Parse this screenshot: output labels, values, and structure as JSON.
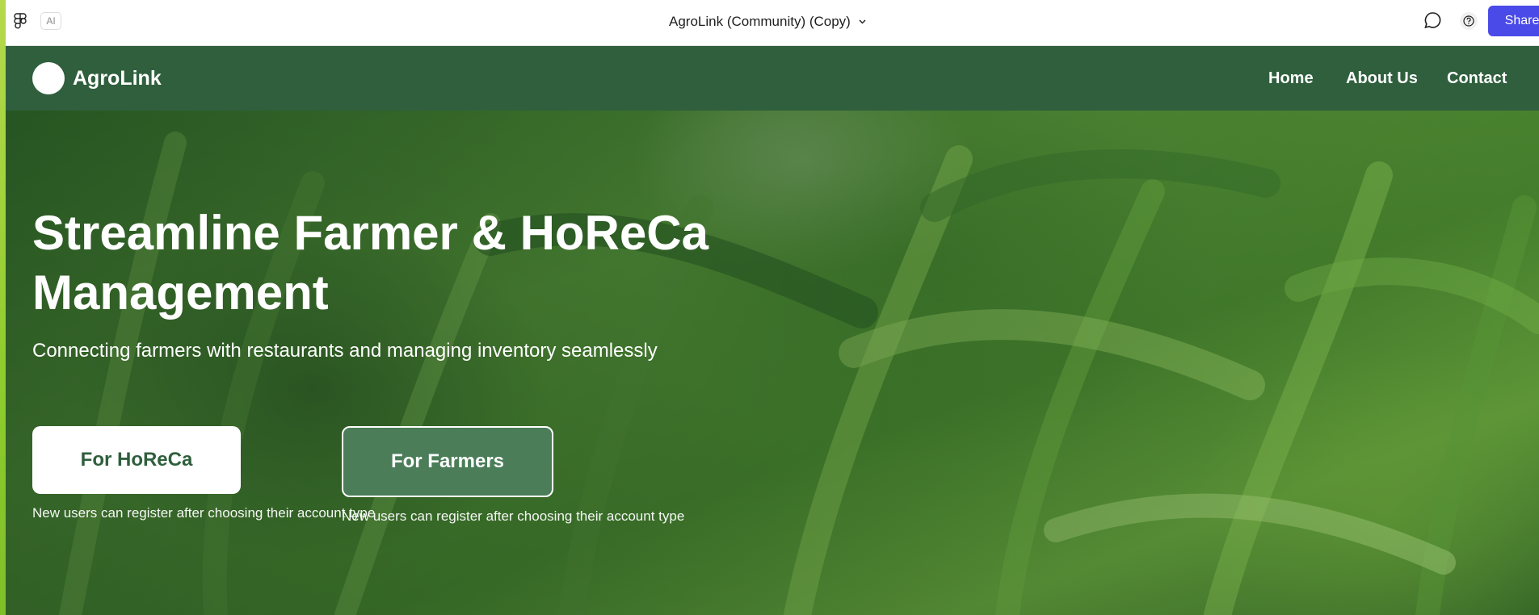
{
  "editor": {
    "file_title": "AgroLink (Community) (Copy)",
    "ai_label": "AI",
    "share_label": "Share",
    "icons": [
      "figma-logo-icon",
      "comment-icon",
      "help-icon",
      "chevron-down-icon"
    ],
    "accent_color": "#4a4ae8"
  },
  "site": {
    "brand": "AgroLink",
    "nav": [
      "Home",
      "About Us",
      "Contact"
    ],
    "hero": {
      "headline": "Streamline Farmer & HoReCa Management",
      "subheadline": "Connecting farmers with restaurants and managing inventory seamlessly",
      "buttons": [
        {
          "label": "For HoReCa",
          "note": "New users can register after choosing their account type"
        },
        {
          "label": "For Farmers",
          "note": "New users can register after choosing their account type"
        }
      ]
    },
    "colors": {
      "nav_bg": "#2f5f3d",
      "primary_green": "#4a7d58",
      "button_text": "#2f5f3d"
    }
  }
}
